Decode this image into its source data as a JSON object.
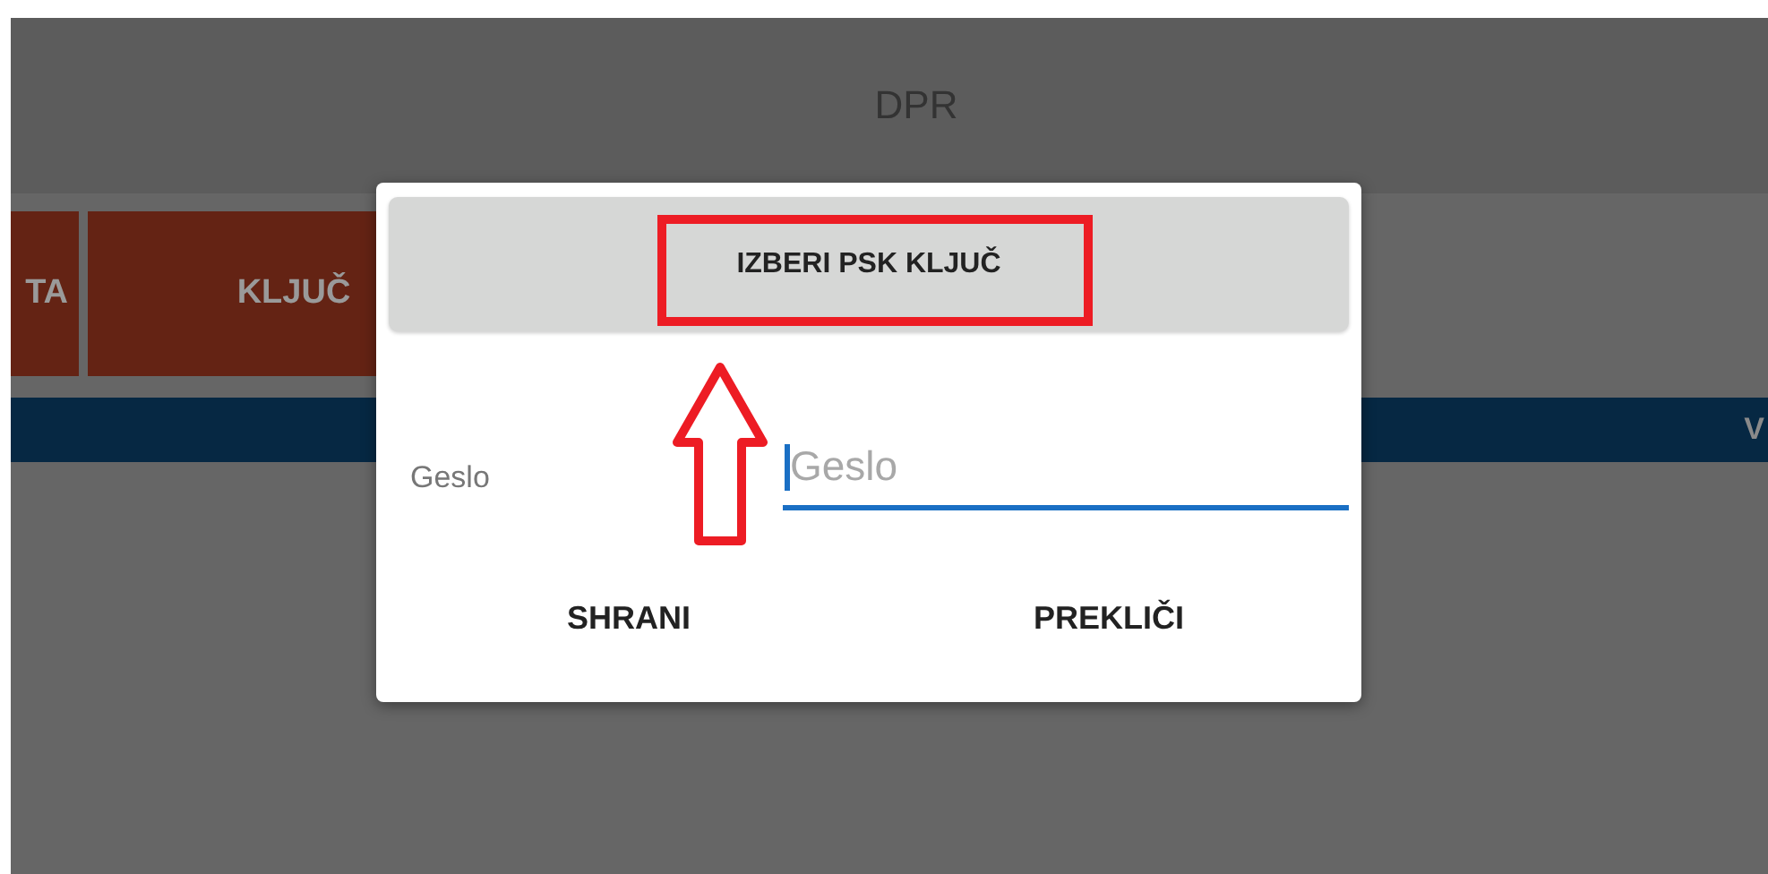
{
  "app_bar": {
    "title": "DPR"
  },
  "tabs": [
    {
      "label": "TA"
    },
    {
      "label": "KLJUČ"
    }
  ],
  "section_bar": {
    "label": "V"
  },
  "dialog": {
    "title_button": "IZBERI PSK KLJUČ",
    "field": {
      "label": "Geslo",
      "placeholder": "Geslo"
    },
    "buttons": [
      "SHRANI",
      "PREKLIČI"
    ]
  }
}
